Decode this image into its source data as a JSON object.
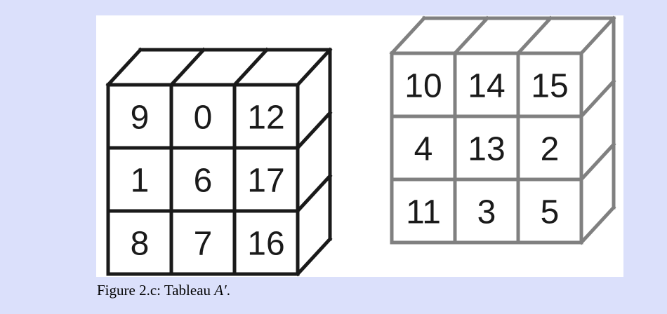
{
  "cube_left": {
    "stroke_color": "#1a1a1a",
    "rows": [
      [
        "9",
        "0",
        "12"
      ],
      [
        "1",
        "6",
        "17"
      ],
      [
        "8",
        "7",
        "16"
      ]
    ]
  },
  "cube_right": {
    "stroke_color": "#808080",
    "rows": [
      [
        "10",
        "14",
        "15"
      ],
      [
        "4",
        "13",
        "2"
      ],
      [
        "11",
        "3",
        "5"
      ]
    ]
  },
  "caption": {
    "label": "Figure 2.c:",
    "text": "Tableau",
    "math": "A′",
    "end": "."
  }
}
